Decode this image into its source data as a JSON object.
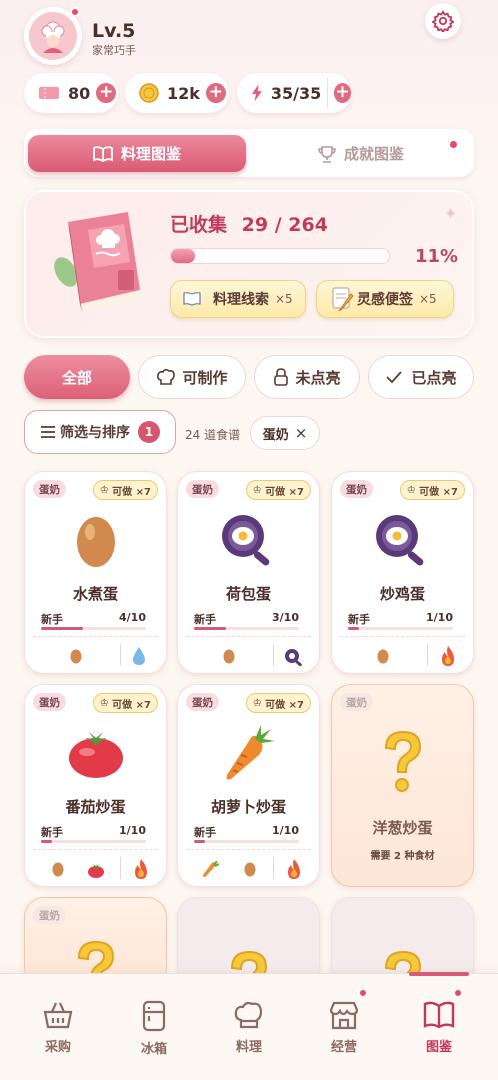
{
  "profile": {
    "level": "Lv.5",
    "title": "家常巧手"
  },
  "resources": [
    {
      "icon": "ticket-icon",
      "value": "80"
    },
    {
      "icon": "coin-icon",
      "value": "12k"
    },
    {
      "icon": "energy-icon",
      "value": "35/35"
    }
  ],
  "tabs": {
    "recipes": "料理图鉴",
    "achievements": "成就图鉴"
  },
  "collection": {
    "label": "已收集",
    "progress": "29 / 264",
    "fraction": 0.11,
    "percent": "11%",
    "clue_label": "料理线索",
    "clue_count": "×5",
    "note_label": "灵感便签",
    "note_count": "×5"
  },
  "filters": {
    "all": "全部",
    "craftable": "可制作",
    "unlit": "未点亮",
    "lit": "已点亮"
  },
  "sort": {
    "label": "筛选与排序",
    "count": "1",
    "recipe_count": "24 道食谱",
    "active_tag": "蛋奶",
    "close": "×"
  },
  "cards": [
    {
      "tag": "蛋奶",
      "cando": "可做 ×7",
      "name": "水煮蛋",
      "level": "新手",
      "progress": "4/10",
      "fraction": 0.4,
      "ingredients": [
        "egg",
        "water"
      ]
    },
    {
      "tag": "蛋奶",
      "cando": "可做 ×7",
      "name": "荷包蛋",
      "level": "新手",
      "progress": "3/10",
      "fraction": 0.3,
      "ingredients": [
        "egg",
        "pan"
      ]
    },
    {
      "tag": "蛋奶",
      "cando": "可做 ×7",
      "name": "炒鸡蛋",
      "level": "新手",
      "progress": "1/10",
      "fraction": 0.1,
      "ingredients": [
        "egg",
        "fire"
      ]
    },
    {
      "tag": "蛋奶",
      "cando": "可做 ×7",
      "name": "番茄炒蛋",
      "level": "新手",
      "progress": "1/10",
      "fraction": 0.1,
      "ingredients": [
        "egg",
        "tomato",
        "fire"
      ]
    },
    {
      "tag": "蛋奶",
      "cando": "可做 ×7",
      "name": "胡萝卜炒蛋",
      "level": "新手",
      "progress": "1/10",
      "fraction": 0.1,
      "ingredients": [
        "carrot",
        "egg",
        "fire"
      ]
    },
    {
      "tag": "蛋奶",
      "name": "洋葱炒蛋",
      "need": "需要 2 种食材"
    }
  ],
  "partial_cards": [
    {
      "tag": "蛋奶"
    }
  ],
  "nav": [
    {
      "label": "采购",
      "icon": "basket-icon"
    },
    {
      "label": "冰箱",
      "icon": "fridge-icon"
    },
    {
      "label": "料理",
      "icon": "chef-hat-icon"
    },
    {
      "label": "经营",
      "icon": "shop-icon"
    },
    {
      "label": "图鉴",
      "icon": "book-icon"
    }
  ],
  "colors": {
    "accent": "#d95a74",
    "gold": "#f4c94a",
    "background": "#fdf6f1"
  }
}
